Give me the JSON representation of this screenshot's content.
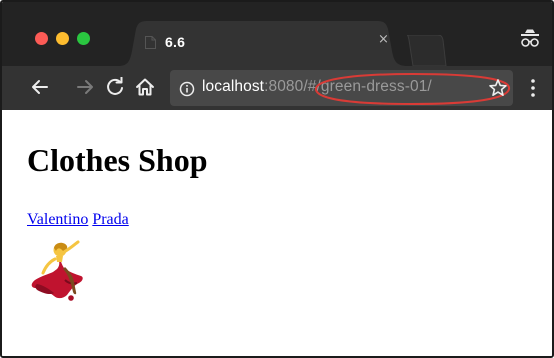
{
  "browser": {
    "tab": {
      "title": "6.6",
      "close_glyph": "×"
    },
    "address_bar": {
      "host": "localhost",
      "port": ":8080",
      "path": "/#/green-dress-01/"
    },
    "icons": [
      "back-icon",
      "forward-icon",
      "reload-icon",
      "home-icon",
      "info-icon",
      "bookmark-star-icon",
      "menu-icon",
      "incognito-icon"
    ],
    "annotation_color": "#d93b36"
  },
  "page": {
    "title": "Clothes Shop",
    "links": [
      "Valentino",
      "Prada"
    ],
    "image_icon": "woman-dancing-emoji"
  }
}
